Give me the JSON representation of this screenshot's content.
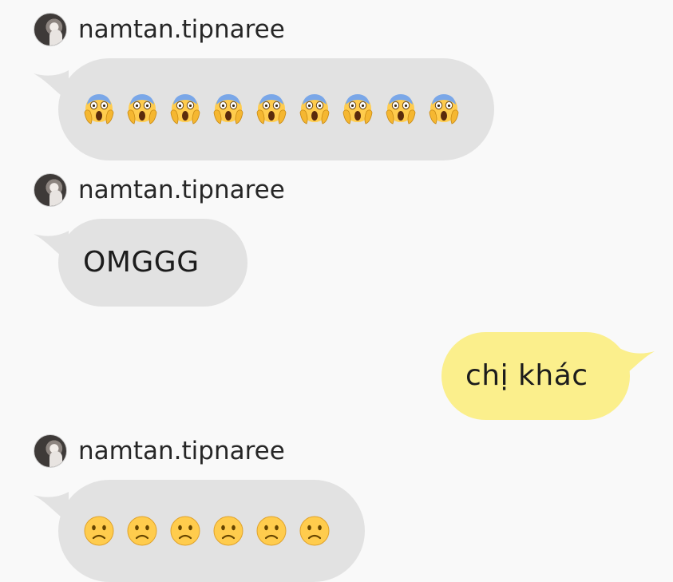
{
  "messages": [
    {
      "direction": "incoming",
      "sender": "namtan.tipnaree",
      "content_type": "emoji",
      "emoji": "face-screaming-in-fear",
      "emoji_count": 9
    },
    {
      "direction": "incoming",
      "sender": "namtan.tipnaree",
      "content_type": "text",
      "text": "OMGGG"
    },
    {
      "direction": "outgoing",
      "content_type": "text",
      "text": "chị khác"
    },
    {
      "direction": "incoming",
      "sender": "namtan.tipnaree",
      "content_type": "emoji",
      "emoji": "slightly-frowning-face",
      "emoji_count": 6
    }
  ],
  "colors": {
    "background": "#f9f9f9",
    "incoming_bubble": "#e2e2e2",
    "outgoing_bubble": "#fbef8c",
    "text": "#1c1c1c"
  }
}
